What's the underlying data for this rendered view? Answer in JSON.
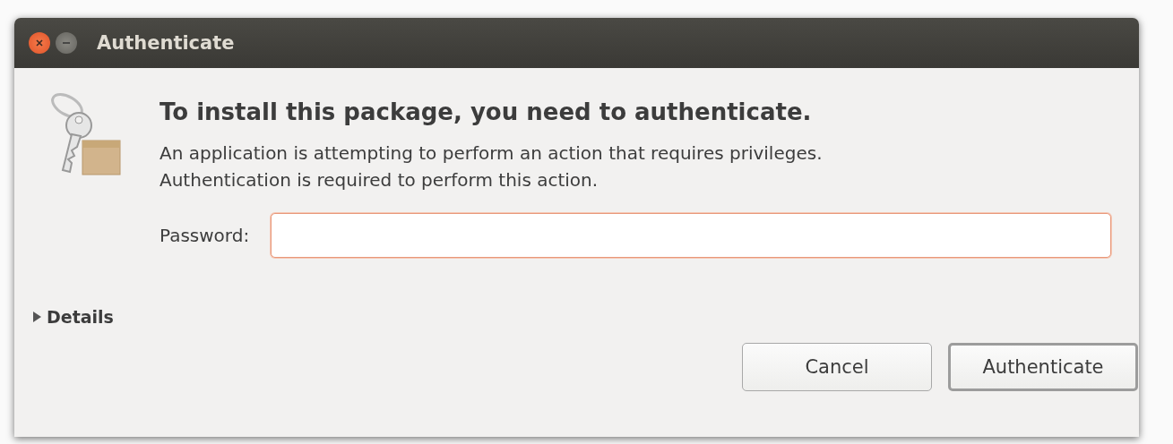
{
  "window": {
    "title": "Authenticate",
    "controls": [
      {
        "kind": "close"
      },
      {
        "kind": "minimize"
      }
    ]
  },
  "heading": "To install this package, you need to authenticate.",
  "message": "An application is attempting to perform an action that requires privileges.\nAuthentication is required to perform this action.",
  "password": {
    "label": "Password:",
    "focused": true
  },
  "details": {
    "label": "Details",
    "expanded": false
  },
  "buttons": [
    {
      "label": "Cancel",
      "default": false
    },
    {
      "label": "Authenticate",
      "default": true
    }
  ]
}
